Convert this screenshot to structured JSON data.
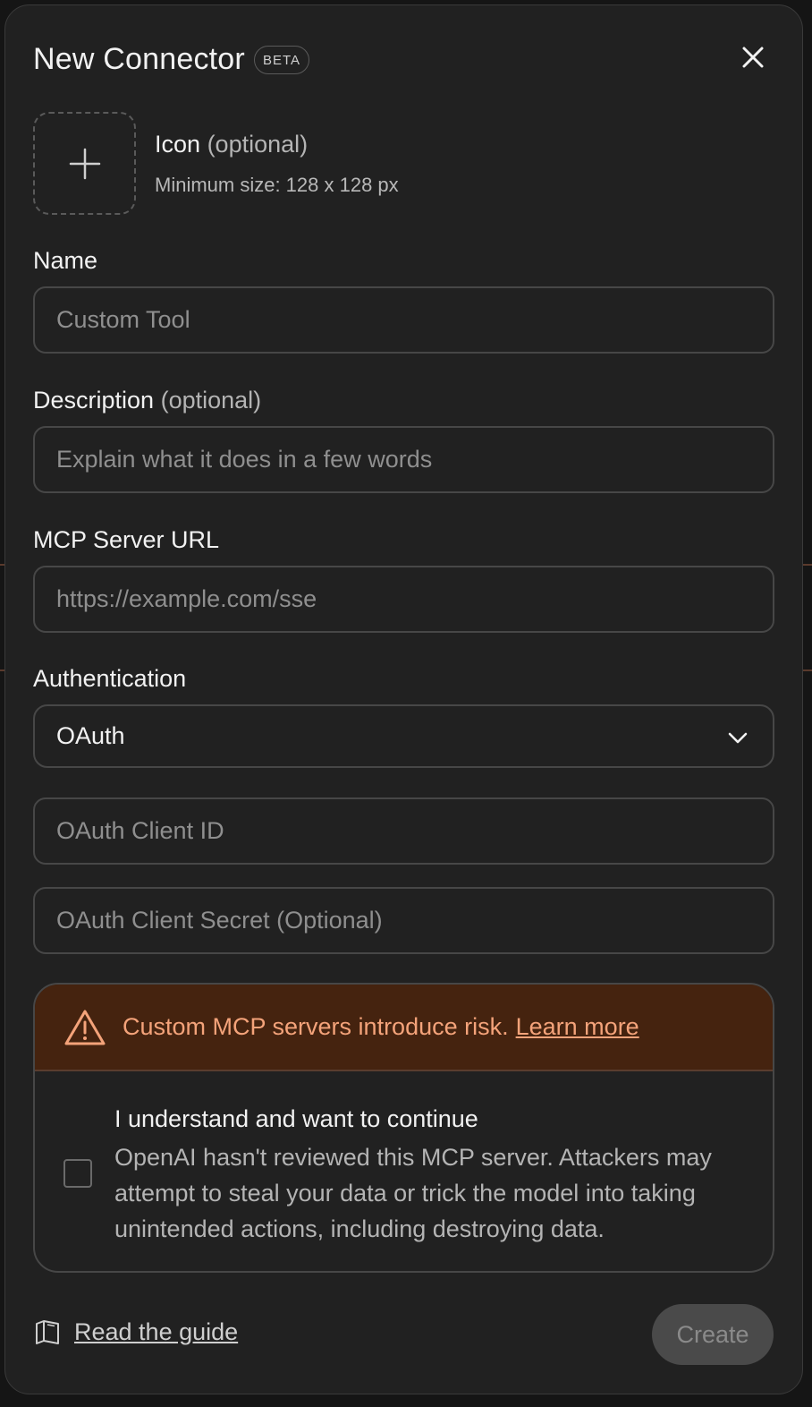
{
  "dialog": {
    "title": "New Connector",
    "badge": "BETA"
  },
  "icon_upload": {
    "label": "Icon",
    "optional": "(optional)",
    "hint": "Minimum size: 128 x 128 px"
  },
  "fields": {
    "name": {
      "label": "Name",
      "placeholder": "Custom Tool",
      "value": ""
    },
    "description": {
      "label": "Description",
      "optional": "(optional)",
      "placeholder": "Explain what it does in a few words",
      "value": ""
    },
    "server_url": {
      "label": "MCP Server URL",
      "placeholder": "https://example.com/sse",
      "value": ""
    },
    "authentication": {
      "label": "Authentication",
      "selected": "OAuth"
    },
    "client_id": {
      "placeholder": "OAuth Client ID",
      "value": ""
    },
    "client_secret": {
      "placeholder": "OAuth Client Secret (Optional)",
      "value": ""
    }
  },
  "warning": {
    "message": "Custom MCP servers introduce risk.",
    "link": "Learn more",
    "ack_title": "I understand and want to continue",
    "ack_body": "OpenAI hasn't reviewed this MCP server. Attackers may attempt to steal your data or trick the model into taking unintended actions, including destroying data.",
    "checked": false
  },
  "footer": {
    "guide_link": "Read the guide",
    "create_button": "Create"
  },
  "colors": {
    "background": "#212121",
    "warning_bg": "#45230f",
    "warning_text": "#f4a37a",
    "border": "#474747"
  },
  "icons": [
    "close-icon",
    "plus-icon",
    "chevron-down-icon",
    "warning-triangle-icon",
    "book-icon"
  ]
}
